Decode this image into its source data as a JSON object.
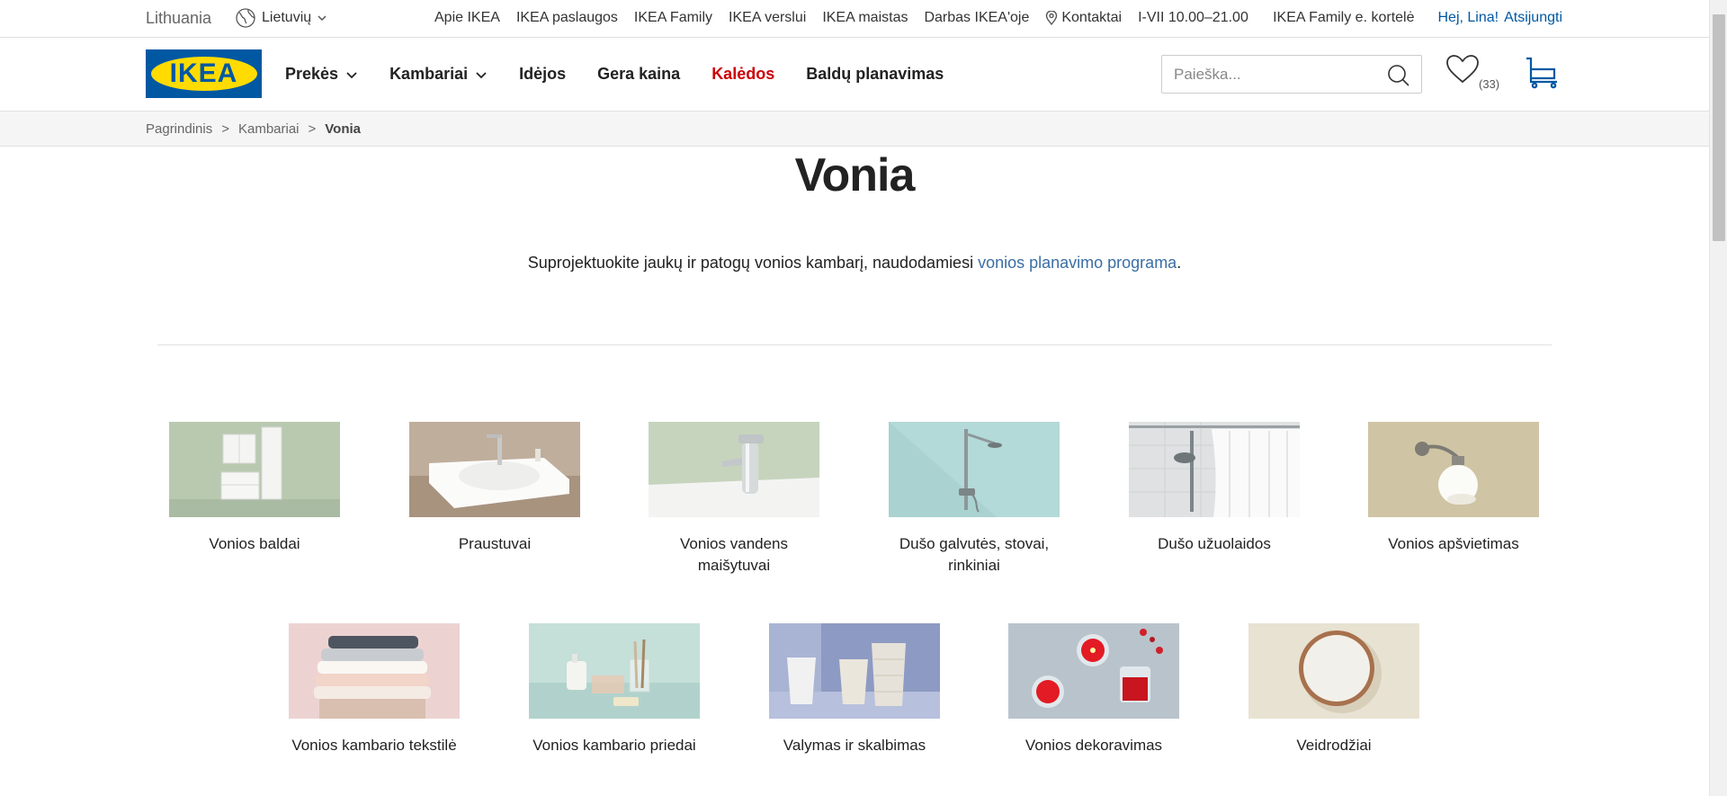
{
  "topbar": {
    "country": "Lithuania",
    "language": "Lietuvių",
    "links": [
      "Apie IKEA",
      "IKEA paslaugos",
      "IKEA Family",
      "IKEA verslui",
      "IKEA maistas",
      "Darbas IKEA'oje"
    ],
    "contact": "Kontaktai",
    "hours": "I-VII 10.00–21.00",
    "family_card": "IKEA Family e. kortelė",
    "greeting": "Hej, Lina!",
    "logout": "Atsijungti"
  },
  "header": {
    "logo_text": "IKEA",
    "nav": [
      "Prekės",
      "Kambariai",
      "Idėjos",
      "Gera kaina",
      "Kalėdos",
      "Baldų planavimas"
    ],
    "search_placeholder": "Paieška...",
    "wishlist_count": "(33)"
  },
  "breadcrumb": [
    "Pagrindinis",
    "Kambariai",
    "Vonia"
  ],
  "breadcrumb_separator": ">",
  "page": {
    "title": "Vonia",
    "intro_text": "Suprojektuokite jaukų ir patogų vonios kambarį, naudodamiesi ",
    "intro_link": "vonios planavimo programa",
    "intro_end": "."
  },
  "categories": [
    {
      "label": "Vonios baldai",
      "icon": "bathroom-cabinet"
    },
    {
      "label": "Praustuvai",
      "icon": "washbasin"
    },
    {
      "label": "Vonios vandens maišytuvai",
      "icon": "faucet"
    },
    {
      "label": "Dušo galvutės, stovai, rinkiniai",
      "icon": "shower-set"
    },
    {
      "label": "Dušo užuolaidos",
      "icon": "shower-curtain"
    },
    {
      "label": "Vonios apšvietimas",
      "icon": "wall-lamp"
    },
    {
      "label": "Vonios kambario tekstilė",
      "icon": "towels"
    },
    {
      "label": "Vonios kambario priedai",
      "icon": "accessories"
    },
    {
      "label": "Valymas ir skalbimas",
      "icon": "laundry-baskets"
    },
    {
      "label": "Vonios dekoravimas",
      "icon": "candles"
    },
    {
      "label": "Veidrodžiai",
      "icon": "round-mirror"
    }
  ],
  "colors": {
    "brand_blue": "#0058a3",
    "brand_yellow": "#ffdb00",
    "accent_red": "#cc0008",
    "link_blue": "#3b6ea5"
  }
}
